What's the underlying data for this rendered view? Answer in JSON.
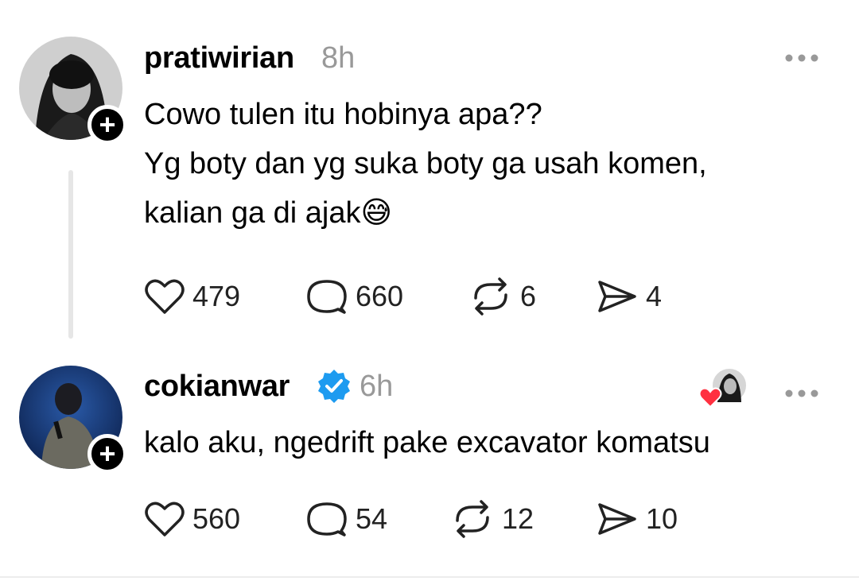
{
  "posts": [
    {
      "username": "pratiwirian",
      "time": "8h",
      "lines": [
        "Cowo tulen itu hobinya apa??",
        "Yg boty  dan yg suka boty ga usah komen,",
        "kalian ga di ajak😅"
      ],
      "likes": "479",
      "comments": "660",
      "reposts": "6",
      "shares": "4"
    },
    {
      "username": "cokianwar",
      "verified": true,
      "time": "6h",
      "lines": [
        "kalo aku, ngedrift pake excavator komatsu"
      ],
      "likes": "560",
      "comments": "54",
      "reposts": "12",
      "shares": "10"
    }
  ],
  "icons": {
    "more": "more-horizontal-icon",
    "like": "heart-icon",
    "comment": "comment-bubble-icon",
    "repost": "repost-icon",
    "share": "send-icon",
    "follow": "plus-icon",
    "verified": "verified-badge-icon",
    "liked_by_author": "red-heart-icon"
  },
  "colors": {
    "verified": "#1d9bf0",
    "heart": "#ff3040",
    "muted": "#999999"
  }
}
